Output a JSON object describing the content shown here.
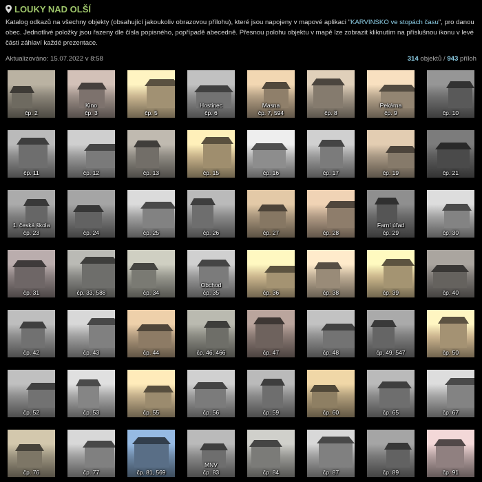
{
  "header": {
    "title": "LOUKY NAD OLŠÍ",
    "desc_part1": "Katalog odkazů na všechny objekty (obsahující jakoukoliv obrazovou přílohu), které jsou napojeny v mapové aplikaci \"",
    "desc_link": "KARVINSKO ve stopách času",
    "desc_part2": "\", pro danou obec. Jednotlivé položky jsou řazeny dle čísla popisného, popřípadě abecedně. Přesnou polohu objektu v mapě lze zobrazit kliknutím na příslušnou ikonu v levé části záhlaví každé prezentace."
  },
  "meta": {
    "updated": "Aktualizováno: 15.07.2022 v 8:58",
    "objects_count": "314",
    "objects_label": " objektů",
    "separator": " / ",
    "attachments_count": "943",
    "attachments_label": " příloh"
  },
  "tiles": [
    {
      "num": "čp. 2",
      "name": "",
      "tone": "#8a8478"
    },
    {
      "num": "čp. 3",
      "name": "Kino",
      "tone": "#9c8f88"
    },
    {
      "num": "čp. 5",
      "name": "",
      "tone": "#c9b590"
    },
    {
      "num": "čp. 6",
      "name": "Hostinec",
      "tone": "#8f8f8f"
    },
    {
      "num": "čp. 7, 594",
      "name": "Masna",
      "tone": "#b39f84"
    },
    {
      "num": "čp. 8",
      "name": "",
      "tone": "#a69a8a"
    },
    {
      "num": "čp. 9",
      "name": "Pekárna",
      "tone": "#b8a68e"
    },
    {
      "num": "čp. 10",
      "name": "",
      "tone": "#6f6f6f"
    },
    {
      "num": "čp. 11",
      "name": "",
      "tone": "#8a8a8a"
    },
    {
      "num": "čp. 12",
      "name": "",
      "tone": "#999999"
    },
    {
      "num": "čp. 13",
      "name": "",
      "tone": "#8e8a82"
    },
    {
      "num": "čp. 15",
      "name": "",
      "tone": "#c7b28a"
    },
    {
      "num": "čp. 16",
      "name": "",
      "tone": "#b0b0b0"
    },
    {
      "num": "čp. 17",
      "name": "",
      "tone": "#9a9a9a"
    },
    {
      "num": "čp. 19",
      "name": "",
      "tone": "#a89884"
    },
    {
      "num": "čp. 21",
      "name": "",
      "tone": "#5c5c5c"
    },
    {
      "num": "čp. 23",
      "name": "1. česká škola",
      "tone": "#7f7f7f"
    },
    {
      "num": "čp. 24",
      "name": "",
      "tone": "#7a7a7a"
    },
    {
      "num": "čp. 25",
      "name": "",
      "tone": "#a2a2a2"
    },
    {
      "num": "čp. 26",
      "name": "",
      "tone": "#8a8a8a"
    },
    {
      "num": "čp. 27",
      "name": "",
      "tone": "#a8957c"
    },
    {
      "num": "čp. 28",
      "name": "",
      "tone": "#b29c86"
    },
    {
      "num": "čp. 29",
      "name": "Farní úřad",
      "tone": "#6a6a6a"
    },
    {
      "num": "čp. 30",
      "name": "",
      "tone": "#a4a4a4"
    },
    {
      "num": "čp. 31",
      "name": "",
      "tone": "#8a8080"
    },
    {
      "num": "čp. 33, 588",
      "name": "",
      "tone": "#8a8a86"
    },
    {
      "num": "čp. 34",
      "name": "",
      "tone": "#999990"
    },
    {
      "num": "čp. 35",
      "name": "Obchod",
      "tone": "#9a9a9a"
    },
    {
      "num": "čp. 36",
      "name": "",
      "tone": "#cdb88f"
    },
    {
      "num": "čp. 38",
      "name": "",
      "tone": "#bfae96"
    },
    {
      "num": "čp. 39",
      "name": "",
      "tone": "#cdb98e"
    },
    {
      "num": "čp. 40",
      "name": "",
      "tone": "#7e7a76"
    },
    {
      "num": "čp. 42",
      "name": "",
      "tone": "#8d8d8d"
    },
    {
      "num": "čp. 43",
      "name": "",
      "tone": "#a0a0a0"
    },
    {
      "num": "čp. 44",
      "name": "",
      "tone": "#b09a7e"
    },
    {
      "num": "čp. 46, 466",
      "name": "",
      "tone": "#8a8a82"
    },
    {
      "num": "čp. 47",
      "name": "",
      "tone": "#8a7a74"
    },
    {
      "num": "čp. 48",
      "name": "",
      "tone": "#909090"
    },
    {
      "num": "čp. 49, 547",
      "name": "",
      "tone": "#7e7e7e"
    },
    {
      "num": "čp. 50",
      "name": "",
      "tone": "#cdb690"
    },
    {
      "num": "čp. 52",
      "name": "",
      "tone": "#8e8e8e"
    },
    {
      "num": "čp. 53",
      "name": "",
      "tone": "#a6a6a6"
    },
    {
      "num": "čp. 55",
      "name": "",
      "tone": "#c2ae8a"
    },
    {
      "num": "čp. 56",
      "name": "",
      "tone": "#9a9a9a"
    },
    {
      "num": "čp. 59",
      "name": "",
      "tone": "#8a8a8a"
    },
    {
      "num": "čp. 60",
      "name": "",
      "tone": "#b29f7c"
    },
    {
      "num": "čp. 65",
      "name": "",
      "tone": "#8a8a8a"
    },
    {
      "num": "čp. 67",
      "name": "",
      "tone": "#a4a4a4"
    },
    {
      "num": "čp. 76",
      "name": "",
      "tone": "#9c9480"
    },
    {
      "num": "čp. 77",
      "name": "",
      "tone": "#a0a0a0"
    },
    {
      "num": "čp. 81, 569",
      "name": "",
      "tone": "#6f8aa8"
    },
    {
      "num": "čp. 83",
      "name": "MNV",
      "tone": "#8a8a8a"
    },
    {
      "num": "čp. 84",
      "name": "",
      "tone": "#9a9a96"
    },
    {
      "num": "čp. 87",
      "name": "",
      "tone": "#a0a0a0"
    },
    {
      "num": "čp. 89",
      "name": "",
      "tone": "#7a7a7a"
    },
    {
      "num": "čp. 91",
      "name": "",
      "tone": "#b4a0a0"
    }
  ]
}
